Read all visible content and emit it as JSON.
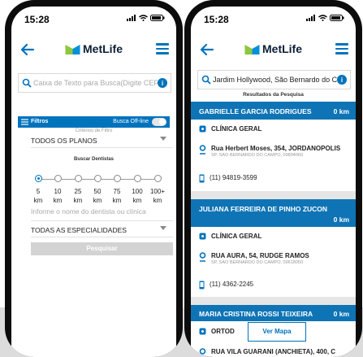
{
  "left": {
    "status": {
      "time": "15:28"
    },
    "header": {
      "logo": "MetLife"
    },
    "search": {
      "placeholder": "Caixa de Texto para Busca(Digite CEP, En"
    },
    "filters": {
      "title": "Filtros",
      "offline_label": "Busca Off-line",
      "criteria_title": "Critérios de Filtro",
      "plan_value": "TODOS OS PLANOS",
      "dentists_title": "Buscar Dentistas",
      "distances": [
        "5",
        "10",
        "25",
        "50",
        "75",
        "100",
        "100+"
      ],
      "unit": "km",
      "selected_distance": "5",
      "name_placeholder": "Informe o nome do dentista ou clínica",
      "specialty_value": "TODAS AS ESPECIALIDADES",
      "search_button": "Pesquisar"
    }
  },
  "right": {
    "status": {
      "time": "15:28"
    },
    "header": {
      "logo": "MetLife"
    },
    "search": {
      "value": "Jardim Hollywood, São Bernardo do Cam"
    },
    "results_title": "Resultados da Pesquisa",
    "results": [
      {
        "name": "GABRIELLE GARCIA RODRIGUES",
        "distance": "0 km",
        "specialty": "CLÍNICA GERAL",
        "address": "Rua Herbert Moses, 354, JORDANOPOLIS",
        "city": "SP, SAO BERNARDO DO CAMPO, 09894060",
        "phone": "(11) 94819-3599"
      },
      {
        "name": "JULIANA FERREIRA DE PINHO ZUCON",
        "distance": "0 km",
        "specialty": "CLÍNICA GERAL",
        "address": "RUA AURA, 54, RUDGE RAMOS",
        "city": "SP, SAO BERNARDO DO CAMPO, 09618050",
        "phone": "(11) 4362-2245"
      },
      {
        "name": "MARIA CRISTINA ROSSI TEIXEIRA",
        "distance": "0 km",
        "specialty": "ORTOD",
        "address": "RUA VILA GUARANI (ANCHIETA), 400, C"
      }
    ],
    "map_button": "Ver Mapa"
  },
  "colors": {
    "brand_blue": "#0073bd",
    "band_blue": "#0f74b5",
    "logo_green": "#8dc63f",
    "logo_blue": "#0090da"
  }
}
